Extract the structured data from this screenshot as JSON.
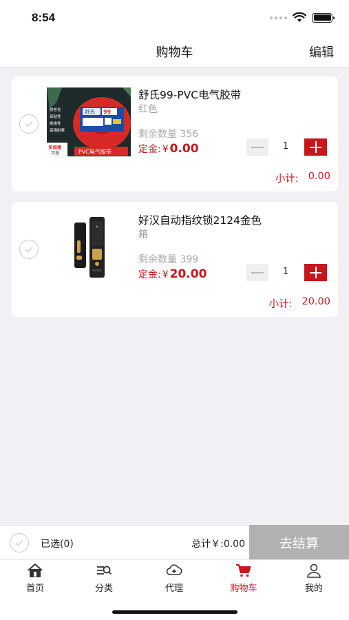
{
  "status_bar": {
    "time": "8:54"
  },
  "nav": {
    "title": "购物车",
    "edit": "编辑"
  },
  "items": [
    {
      "name": "舒氏99-PVC电气胶带",
      "spec": "红色",
      "stock": "剩余数量 356",
      "price_label": "定金:",
      "currency": "¥",
      "price": "0.00",
      "quantity": "1",
      "subtotal_label": "小计:",
      "subtotal_value": "0.00",
      "image_texts": [
        "舒氏",
        "99",
        "耐老化",
        "高粘性",
        "绝缘性",
        "高弹耐寒",
        "多规格",
        "可选",
        "PVC电气胶带"
      ]
    },
    {
      "name": "好汉自动指纹锁2124金色",
      "spec": "箱",
      "stock": "剩余数量 399",
      "price_label": "定金:",
      "currency": "¥",
      "price": "20.00",
      "quantity": "1",
      "subtotal_label": "小计:",
      "subtotal_value": "20.00"
    }
  ],
  "checkout": {
    "selected": "已选(0)",
    "total": "总计￥:0.00",
    "button": "去结算"
  },
  "tabs": [
    {
      "label": "首页",
      "icon": "home-icon"
    },
    {
      "label": "分类",
      "icon": "category-search-icon"
    },
    {
      "label": "代理",
      "icon": "cloud-plus-icon"
    },
    {
      "label": "购物车",
      "icon": "cart-icon"
    },
    {
      "label": "我的",
      "icon": "user-icon"
    }
  ],
  "colors": {
    "accent": "#c8161d",
    "checkout_disabled": "#b1b1b1",
    "background": "#f1f1f5"
  }
}
